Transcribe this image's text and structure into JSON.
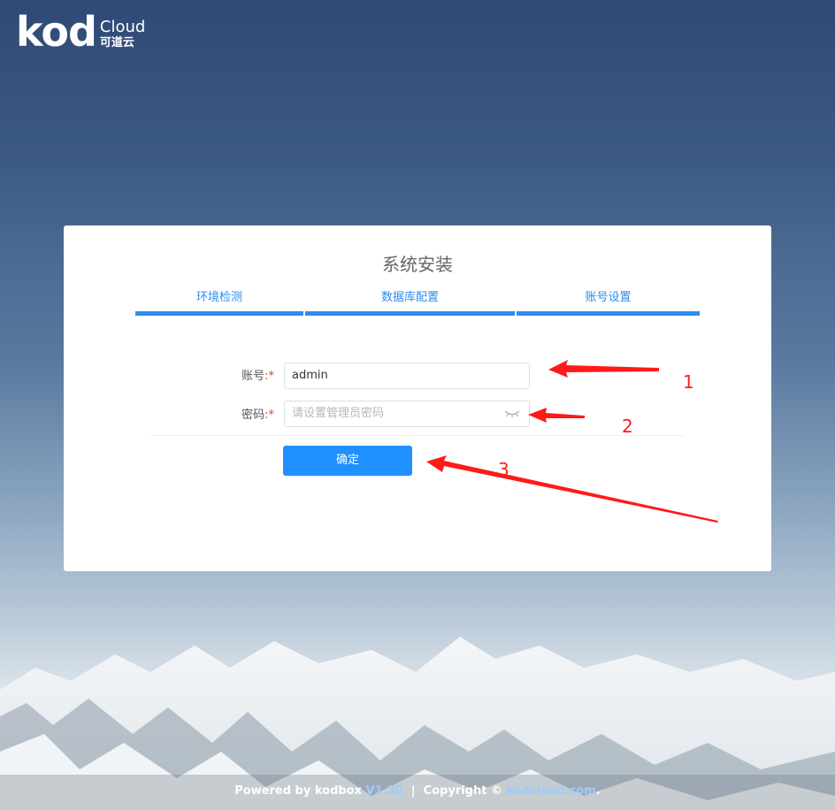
{
  "logo": {
    "brand": "kod",
    "cloud": "Cloud",
    "cn": "可道云"
  },
  "card": {
    "title": "系统安装",
    "steps": [
      {
        "label": "环境检测"
      },
      {
        "label": "数据库配置"
      },
      {
        "label": "账号设置"
      }
    ],
    "account": {
      "label": "账号",
      "value": "admin"
    },
    "password": {
      "label": "密码",
      "placeholder": "请设置管理员密码"
    },
    "required_mark": "*",
    "label_colon": ":",
    "submit_label": "确定"
  },
  "annotations": {
    "n1": "1",
    "n2": "2",
    "n3": "3",
    "color": "#ff1a1a"
  },
  "footer": {
    "powered": "Powered by kodbox",
    "version": "V1.30",
    "separator": "|",
    "copyright": "Copyright ©",
    "site": "kodcloud.com",
    "end": "."
  },
  "colors": {
    "accent": "#2d8cf0",
    "button": "#1e90ff"
  }
}
